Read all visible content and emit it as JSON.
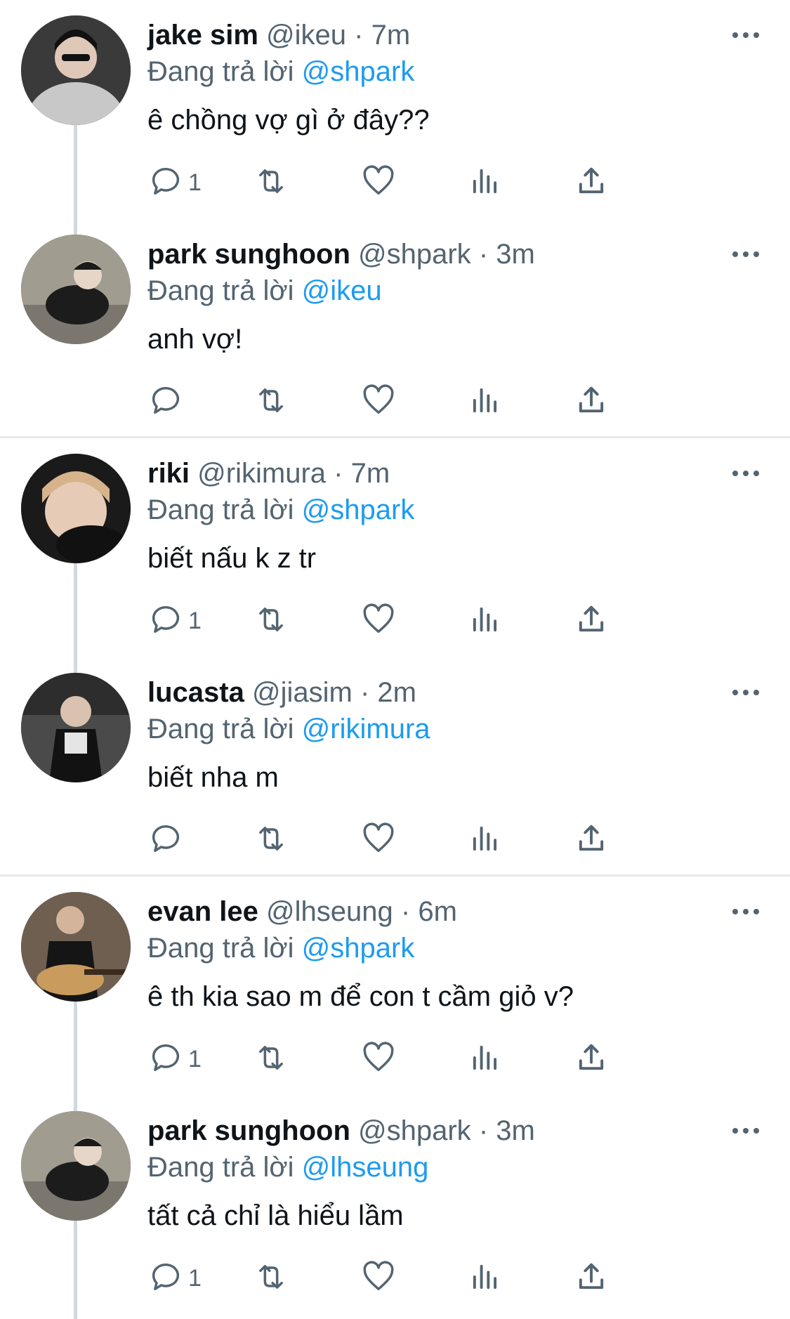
{
  "tweets": [
    {
      "name": "jake sim",
      "handle": "@ikeu",
      "time": "7m",
      "reply_prefix": "Đang trả lời",
      "reply_to": "@shpark",
      "text": "ê chồng vợ gì ở đây??",
      "reply_count": "1",
      "avatar_colors": [
        "#c8c6c6",
        "#1a1a1a"
      ]
    },
    {
      "name": "park sunghoon",
      "handle": "@shpark",
      "time": "3m",
      "reply_prefix": "Đang trả lời",
      "reply_to": "@ikeu",
      "text": "anh vợ!",
      "reply_count": "",
      "avatar_colors": [
        "#9a958a",
        "#222"
      ]
    },
    {
      "name": "riki",
      "handle": "@rikimura",
      "time": "7m",
      "reply_prefix": "Đang trả lời",
      "reply_to": "@shpark",
      "text": "biết nấu k z tr",
      "reply_count": "1",
      "avatar_colors": [
        "#cfae88",
        "#111"
      ]
    },
    {
      "name": "lucasta",
      "handle": "@jiasim",
      "time": "2m",
      "reply_prefix": "Đang trả lời",
      "reply_to": "@rikimura",
      "text": "biết nha m",
      "reply_count": "",
      "avatar_colors": [
        "#5b5b5b",
        "#111"
      ]
    },
    {
      "name": "evan lee",
      "handle": "@lhseung",
      "time": "6m",
      "reply_prefix": "Đang trả lời",
      "reply_to": "@shpark",
      "text": "ê th kia sao m để con t cầm giỏ v?",
      "reply_count": "1",
      "avatar_colors": [
        "#7a6a5a",
        "#151515"
      ]
    },
    {
      "name": "park sunghoon",
      "handle": "@shpark",
      "time": "3m",
      "reply_prefix": "Đang trả lời",
      "reply_to": "@lhseung",
      "text": "tất cả chỉ là hiểu lầm",
      "reply_count": "1",
      "avatar_colors": [
        "#9a958a",
        "#222"
      ]
    }
  ],
  "icons": {
    "reply": "reply-icon",
    "retweet": "retweet-icon",
    "like": "heart-icon",
    "views": "views-icon",
    "share": "share-icon",
    "more": "more-icon"
  },
  "colors": {
    "text_primary": "#0f1419",
    "text_secondary": "#536471",
    "accent": "#1d9bf0",
    "thread_line": "#cfd9de",
    "divider": "#e6e9eb"
  }
}
